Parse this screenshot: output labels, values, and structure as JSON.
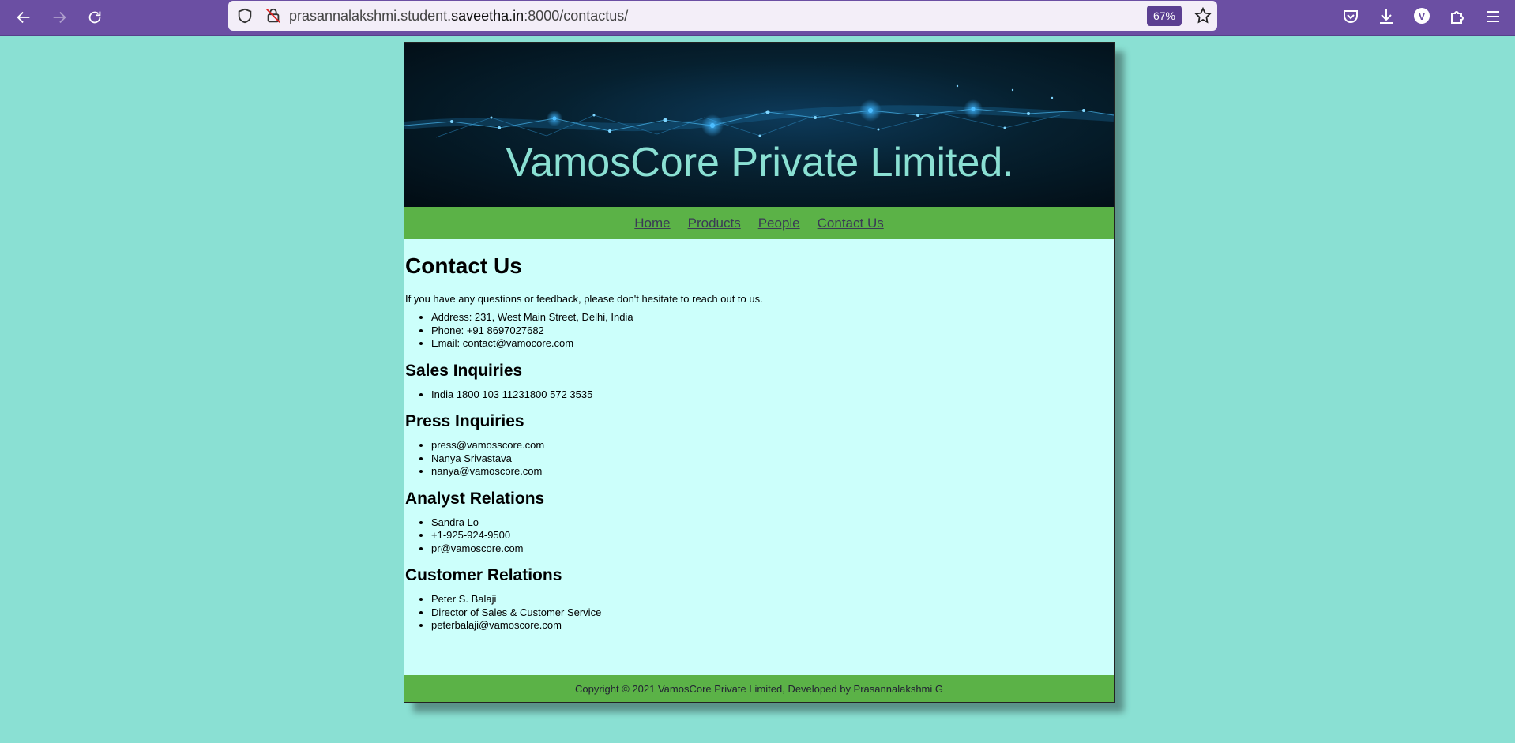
{
  "browser": {
    "url_prefix": "prasannalakshmi.student.",
    "url_domain": "saveetha.in",
    "url_suffix": ":8000/contactus/",
    "zoom": "67%",
    "profile_initial": "V"
  },
  "site": {
    "title": "VamosCore Private Limited.",
    "nav": [
      "Home",
      "Products",
      "People",
      "Contact Us"
    ],
    "heading": "Contact Us",
    "intro": "If you have any questions or feedback, please don't hesitate to reach out to us.",
    "contact": [
      "Address: 231, West Main Street, Delhi, India",
      "Phone: +91 8697027682",
      "Email: contact@vamocore.com"
    ],
    "sections": [
      {
        "title": "Sales Inquiries",
        "items": [
          "India 1800 103 11231800 572 3535"
        ]
      },
      {
        "title": "Press Inquiries",
        "items": [
          "press@vamosscore.com",
          "Nanya Srivastava",
          "nanya@vamoscore.com"
        ]
      },
      {
        "title": "Analyst Relations",
        "items": [
          "Sandra Lo",
          "+1-925-924-9500",
          "pr@vamoscore.com"
        ]
      },
      {
        "title": "Customer Relations",
        "items": [
          "Peter S. Balaji",
          "Director of Sales & Customer Service",
          "peterbalaji@vamoscore.com"
        ]
      }
    ],
    "footer": "Copyright © 2021 VamosCore Private Limited, Developed by Prasannalakshmi G"
  }
}
